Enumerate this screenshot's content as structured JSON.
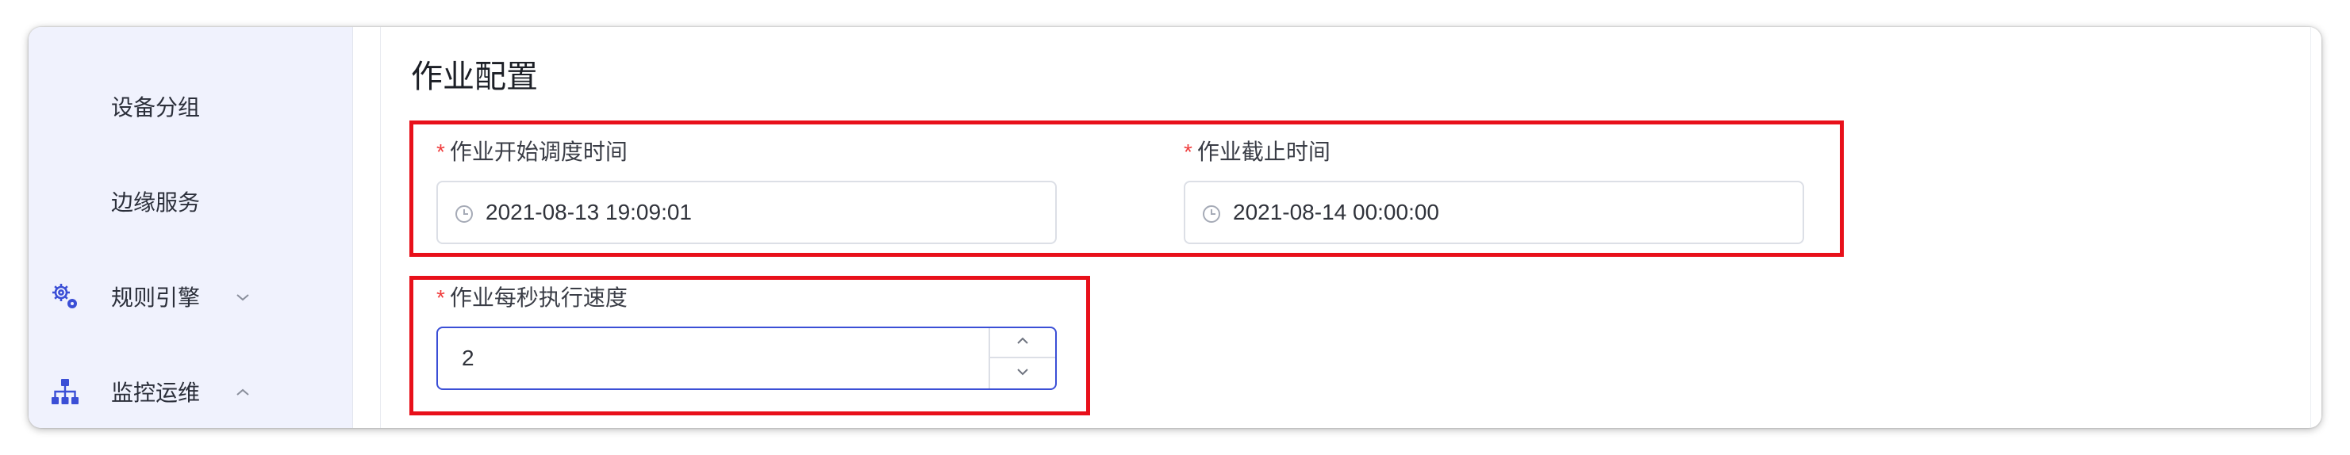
{
  "sidebar": {
    "items": [
      {
        "label": "设备分组",
        "icon": "",
        "chevron": ""
      },
      {
        "label": "边缘服务",
        "icon": "",
        "chevron": ""
      },
      {
        "label": "规则引擎",
        "icon": "gears-icon",
        "chevron": "chevron-down-icon"
      },
      {
        "label": "监控运维",
        "icon": "sitemap-icon",
        "chevron": "chevron-up-icon"
      }
    ]
  },
  "main": {
    "title": "作业配置",
    "required_mark": "*",
    "start_time": {
      "label": "作业开始调度时间",
      "value": "2021-08-13 19:09:01",
      "icon": "clock-icon"
    },
    "end_time": {
      "label": "作业截止时间",
      "value": "2021-08-14 00:00:00",
      "icon": "clock-icon"
    },
    "speed": {
      "label": "作业每秒执行速度",
      "value": "2"
    }
  },
  "colors": {
    "highlight": "#e8101a",
    "required": "#f03e3e",
    "focus_border": "#3b4fd6",
    "sidebar_bg": "#f0f2fd",
    "icon_accent": "#3b4fd6"
  }
}
